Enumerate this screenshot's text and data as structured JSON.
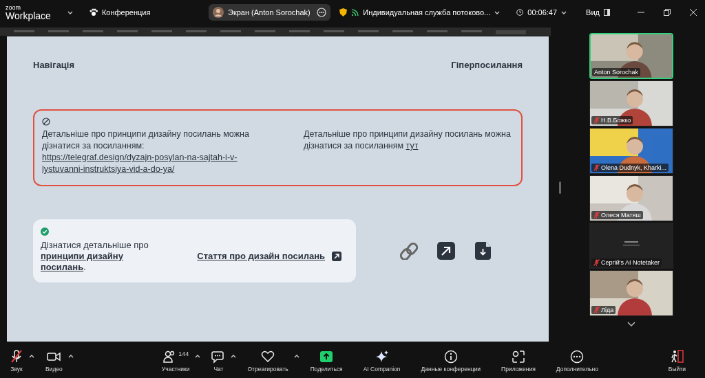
{
  "app": {
    "brand_top": "zoom",
    "brand_bottom": "Workplace"
  },
  "meeting_menu": {
    "label": "Конференция"
  },
  "share_pill": {
    "label": "Экран (Anton Sorochak)"
  },
  "stream": {
    "label": "Индивидуальная служба потоково..."
  },
  "timer": {
    "label": "00:06:47"
  },
  "view_menu": {
    "label": "Вид"
  },
  "slide": {
    "headings": [
      "Навігація",
      "Гіперпосилання"
    ],
    "bad_example": {
      "columns": [
        {
          "text": "Детальніше про принципи дизайну посилань можна дізнатися за посиланням: ",
          "link": "https://telegraf.design/dyzajn-posylan-na-sajtah-i-v-lystuvanni-instruktsiya-vid-a-do-ya/"
        },
        {
          "text": "Детальніше про принципи дизайну посилань можна дізнатися за посиланням ",
          "link": "тут"
        }
      ]
    },
    "good_example": {
      "text": "Дізнатися детальніше про **принципи дизайну посилань**.",
      "link": "Стаття про дизайн посилань"
    },
    "icons": [
      {
        "kind": "chain"
      },
      {
        "kind": "arrow"
      },
      {
        "kind": "download"
      }
    ]
  },
  "participants": [
    {
      "name": "Anton Sorochak",
      "muted": false,
      "speaking": true,
      "video": true
    },
    {
      "name": "Н.В.Божко",
      "muted": true,
      "speaking": false,
      "video": true
    },
    {
      "name": "Olena Dudnyk, Kharki...",
      "muted": true,
      "speaking": false,
      "video": true
    },
    {
      "name": "Олеся Матяш",
      "muted": true,
      "speaking": false,
      "video": true
    },
    {
      "name": "Сергій's AI Notetaker",
      "muted": true,
      "speaking": false,
      "video": false
    },
    {
      "name": "Ліда",
      "muted": true,
      "speaking": false,
      "video": true
    }
  ],
  "toolbar": [
    {
      "label": "Звук",
      "kind": "mic",
      "muted": true,
      "menu": true
    },
    {
      "label": "Видео",
      "kind": "camera",
      "menu": true
    },
    {
      "label": "Участники",
      "kind": "people",
      "count": "144",
      "menu": true
    },
    {
      "label": "Чат",
      "kind": "chat",
      "menu": true
    },
    {
      "label": "Отреагировать",
      "kind": "heart",
      "menu": true
    },
    {
      "label": "Поделиться",
      "kind": "share",
      "menu": false
    },
    {
      "label": "AI Companion",
      "kind": "sparkle",
      "menu": false
    },
    {
      "label": "Данные конференции",
      "kind": "info",
      "menu": false
    },
    {
      "label": "Приложения",
      "kind": "apps",
      "menu": false
    },
    {
      "label": "Дополнительно",
      "kind": "more",
      "menu": false
    },
    {
      "label": "Выйти",
      "kind": "leave",
      "menu": false
    }
  ]
}
